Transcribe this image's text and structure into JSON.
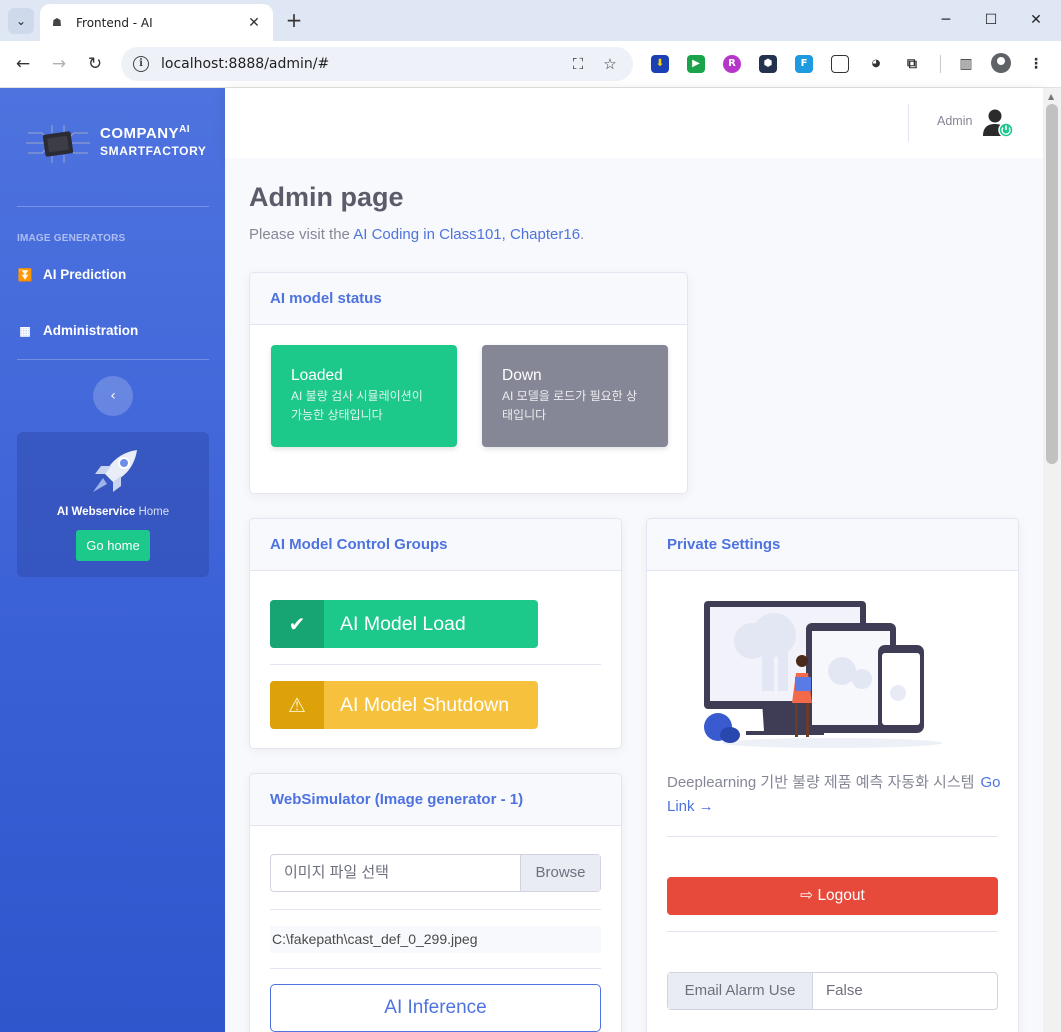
{
  "browser": {
    "tab_title": "Frontend - AI",
    "url": "localhost:8888/admin/#"
  },
  "sidebar": {
    "brand_line1": "COMPANY",
    "brand_sup": "AI",
    "brand_line2": "SMARTFACTORY",
    "heading": "IMAGE GENERATORS",
    "items": [
      {
        "label": "AI Prediction"
      },
      {
        "label": "Administration"
      }
    ],
    "promo": {
      "title_bold": "AI Webservice",
      "title_rest": " Home",
      "button": "Go home"
    }
  },
  "topbar": {
    "user_name": "Admin"
  },
  "page": {
    "title": "Admin page",
    "subtitle_prefix": "Please visit the ",
    "subtitle_link": "AI Coding in Class101, Chapter16",
    "subtitle_suffix": "."
  },
  "model_status": {
    "header": "AI model status",
    "loaded": {
      "title": "Loaded",
      "desc": "AI 불량 검사 시뮬레이션이 가능한 상태입니다"
    },
    "down": {
      "title": "Down",
      "desc": "AI 모델을 로드가 필요한 상태입니다"
    }
  },
  "control_groups": {
    "header": "AI Model Control Groups",
    "load_label": "AI Model Load",
    "shutdown_label": "AI Model Shutdown"
  },
  "simulator": {
    "header": "WebSimulator (Image generator - 1)",
    "file_placeholder": "이미지 파일 선택",
    "browse_label": "Browse",
    "file_path": "C:\\fakepath\\cast_def_0_299.jpeg",
    "inference_label": "AI Inference"
  },
  "private_settings": {
    "header": "Private Settings",
    "description": "Deeplearning 기반 불량 제품 예측 자동화 시스템",
    "link": "Go Link →",
    "logout_label": "Logout",
    "email_label": "Email Alarm Use",
    "email_value": "False"
  },
  "colors": {
    "primary": "#4e73df",
    "success": "#1cc88a",
    "warning": "#f6c23e",
    "danger": "#e74a3b",
    "secondary": "#858796"
  }
}
